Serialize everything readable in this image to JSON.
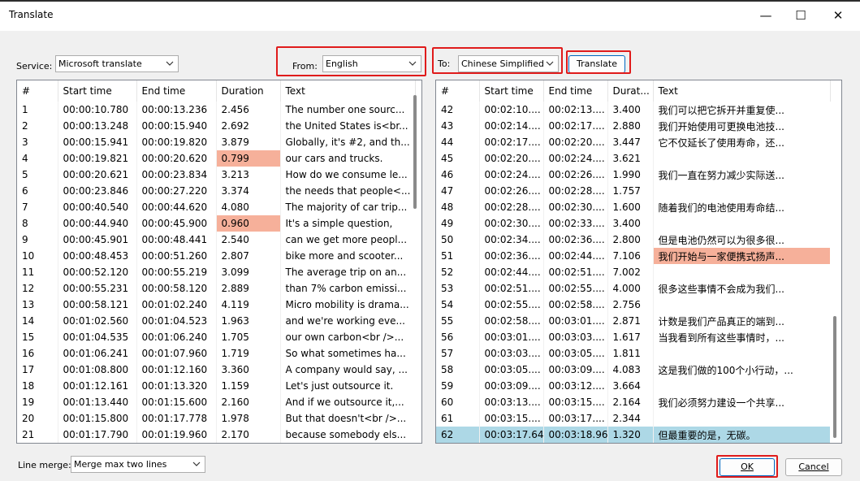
{
  "window": {
    "title": "Translate",
    "minimize": "—",
    "maximize": "☐",
    "close": "✕"
  },
  "service": {
    "label": "Service:",
    "value": "Microsoft translate"
  },
  "from": {
    "label": "From:",
    "value": "English"
  },
  "to": {
    "label": "To:",
    "value": "Chinese Simplified"
  },
  "translate_button": "Translate",
  "line_merge": {
    "label": "Line merge:",
    "value": "Merge max two lines"
  },
  "ok_button": "OK",
  "cancel_button": "Cancel",
  "left_grid": {
    "columns": [
      "#",
      "Start time",
      "End time",
      "Duration",
      "Text"
    ],
    "rows": [
      {
        "n": "1",
        "start": "00:00:10.780",
        "end": "00:00:13.236",
        "dur": "2.456",
        "text": "The number one sourc...",
        "warn": false
      },
      {
        "n": "2",
        "start": "00:00:13.248",
        "end": "00:00:15.940",
        "dur": "2.692",
        "text": "the United States is<br...",
        "warn": false
      },
      {
        "n": "3",
        "start": "00:00:15.941",
        "end": "00:00:19.820",
        "dur": "3.879",
        "text": "Globally, it's #2, and th...",
        "warn": false
      },
      {
        "n": "4",
        "start": "00:00:19.821",
        "end": "00:00:20.620",
        "dur": "0.799",
        "text": "our cars and trucks.",
        "warn": true
      },
      {
        "n": "5",
        "start": "00:00:20.621",
        "end": "00:00:23.834",
        "dur": "3.213",
        "text": "How do we consume le...",
        "warn": false
      },
      {
        "n": "6",
        "start": "00:00:23.846",
        "end": "00:00:27.220",
        "dur": "3.374",
        "text": "the needs that people<...",
        "warn": false
      },
      {
        "n": "7",
        "start": "00:00:40.540",
        "end": "00:00:44.620",
        "dur": "4.080",
        "text": "The majority of car trip...",
        "warn": false
      },
      {
        "n": "8",
        "start": "00:00:44.940",
        "end": "00:00:45.900",
        "dur": "0.960",
        "text": "It's a simple question,",
        "warn": true
      },
      {
        "n": "9",
        "start": "00:00:45.901",
        "end": "00:00:48.441",
        "dur": "2.540",
        "text": "can we get more peopl...",
        "warn": false
      },
      {
        "n": "10",
        "start": "00:00:48.453",
        "end": "00:00:51.260",
        "dur": "2.807",
        "text": "bike more and scooter...",
        "warn": false
      },
      {
        "n": "11",
        "start": "00:00:52.120",
        "end": "00:00:55.219",
        "dur": "3.099",
        "text": "The average trip on an...",
        "warn": false
      },
      {
        "n": "12",
        "start": "00:00:55.231",
        "end": "00:00:58.120",
        "dur": "2.889",
        "text": "than 7% carbon emissi...",
        "warn": false
      },
      {
        "n": "13",
        "start": "00:00:58.121",
        "end": "00:01:02.240",
        "dur": "4.119",
        "text": "Micro mobility is drama...",
        "warn": false
      },
      {
        "n": "14",
        "start": "00:01:02.560",
        "end": "00:01:04.523",
        "dur": "1.963",
        "text": "and we're working eve...",
        "warn": false
      },
      {
        "n": "15",
        "start": "00:01:04.535",
        "end": "00:01:06.240",
        "dur": "1.705",
        "text": "our own carbon<br />...",
        "warn": false
      },
      {
        "n": "16",
        "start": "00:01:06.241",
        "end": "00:01:07.960",
        "dur": "1.719",
        "text": "So what sometimes ha...",
        "warn": false
      },
      {
        "n": "17",
        "start": "00:01:08.800",
        "end": "00:01:12.160",
        "dur": "3.360",
        "text": "A company would say, ...",
        "warn": false
      },
      {
        "n": "18",
        "start": "00:01:12.161",
        "end": "00:01:13.320",
        "dur": "1.159",
        "text": "Let's just outsource it.",
        "warn": false
      },
      {
        "n": "19",
        "start": "00:01:13.440",
        "end": "00:01:15.600",
        "dur": "2.160",
        "text": "And if we outsource it,...",
        "warn": false
      },
      {
        "n": "20",
        "start": "00:01:15.800",
        "end": "00:01:17.778",
        "dur": "1.978",
        "text": "But that doesn't<br />...",
        "warn": false
      },
      {
        "n": "21",
        "start": "00:01:17.790",
        "end": "00:01:19.960",
        "dur": "2.170",
        "text": "because somebody els...",
        "warn": false
      }
    ]
  },
  "right_grid": {
    "columns": [
      "#",
      "Start time",
      "End time",
      "Durat...",
      "Text"
    ],
    "rows": [
      {
        "n": "42",
        "start": "00:02:10....",
        "end": "00:02:13....",
        "dur": "3.400",
        "text": "我们可以把它拆开并重复使...",
        "warn": false,
        "sel": false
      },
      {
        "n": "43",
        "start": "00:02:14....",
        "end": "00:02:17....",
        "dur": "2.880",
        "text": "我们开始使用可更换电池技...",
        "warn": false,
        "sel": false
      },
      {
        "n": "44",
        "start": "00:02:17....",
        "end": "00:02:20....",
        "dur": "3.447",
        "text": "它不仅延长了使用寿命，还...",
        "warn": false,
        "sel": false
      },
      {
        "n": "45",
        "start": "00:02:20....",
        "end": "00:02:24....",
        "dur": "3.621",
        "text": "",
        "warn": false,
        "sel": false
      },
      {
        "n": "46",
        "start": "00:02:24....",
        "end": "00:02:26....",
        "dur": "1.990",
        "text": "我们一直在努力减少实际送...",
        "warn": false,
        "sel": false
      },
      {
        "n": "47",
        "start": "00:02:26....",
        "end": "00:02:28....",
        "dur": "1.757",
        "text": "",
        "warn": false,
        "sel": false
      },
      {
        "n": "48",
        "start": "00:02:28....",
        "end": "00:02:30....",
        "dur": "1.600",
        "text": "随着我们的电池使用寿命结...",
        "warn": false,
        "sel": false
      },
      {
        "n": "49",
        "start": "00:02:30....",
        "end": "00:02:33....",
        "dur": "3.400",
        "text": "",
        "warn": false,
        "sel": false
      },
      {
        "n": "50",
        "start": "00:02:34....",
        "end": "00:02:36....",
        "dur": "2.800",
        "text": "但是电池仍然可以为很多很...",
        "warn": false,
        "sel": false
      },
      {
        "n": "51",
        "start": "00:02:36....",
        "end": "00:02:44....",
        "dur": "7.106",
        "text": "我们开始与一家便携式扬声...",
        "warn": true,
        "sel": false
      },
      {
        "n": "52",
        "start": "00:02:44....",
        "end": "00:02:51....",
        "dur": "7.002",
        "text": "",
        "warn": false,
        "sel": false
      },
      {
        "n": "53",
        "start": "00:02:51....",
        "end": "00:02:55....",
        "dur": "4.000",
        "text": "很多这些事情不会成为我们...",
        "warn": false,
        "sel": false
      },
      {
        "n": "54",
        "start": "00:02:55....",
        "end": "00:02:58....",
        "dur": "2.756",
        "text": "",
        "warn": false,
        "sel": false
      },
      {
        "n": "55",
        "start": "00:02:58....",
        "end": "00:03:01....",
        "dur": "2.871",
        "text": "计数是我们产品真正的端到...",
        "warn": false,
        "sel": false
      },
      {
        "n": "56",
        "start": "00:03:01....",
        "end": "00:03:03....",
        "dur": "1.617",
        "text": "当我看到所有这些事情时，...",
        "warn": false,
        "sel": false
      },
      {
        "n": "57",
        "start": "00:03:03....",
        "end": "00:03:05....",
        "dur": "1.811",
        "text": "",
        "warn": false,
        "sel": false
      },
      {
        "n": "58",
        "start": "00:03:05....",
        "end": "00:03:09....",
        "dur": "4.083",
        "text": "这是我们做的100个小行动，...",
        "warn": false,
        "sel": false
      },
      {
        "n": "59",
        "start": "00:03:09....",
        "end": "00:03:12....",
        "dur": "3.664",
        "text": "",
        "warn": false,
        "sel": false
      },
      {
        "n": "60",
        "start": "00:03:13....",
        "end": "00:03:15....",
        "dur": "2.164",
        "text": "我们必须努力建设一个共享...",
        "warn": false,
        "sel": false
      },
      {
        "n": "61",
        "start": "00:03:15....",
        "end": "00:03:17....",
        "dur": "2.344",
        "text": "",
        "warn": false,
        "sel": false
      },
      {
        "n": "62",
        "start": "00:03:17.64",
        "end": "00:03:18.96",
        "dur": "1.320",
        "text": "但最重要的是，无碳。",
        "warn": false,
        "sel": true
      }
    ]
  }
}
